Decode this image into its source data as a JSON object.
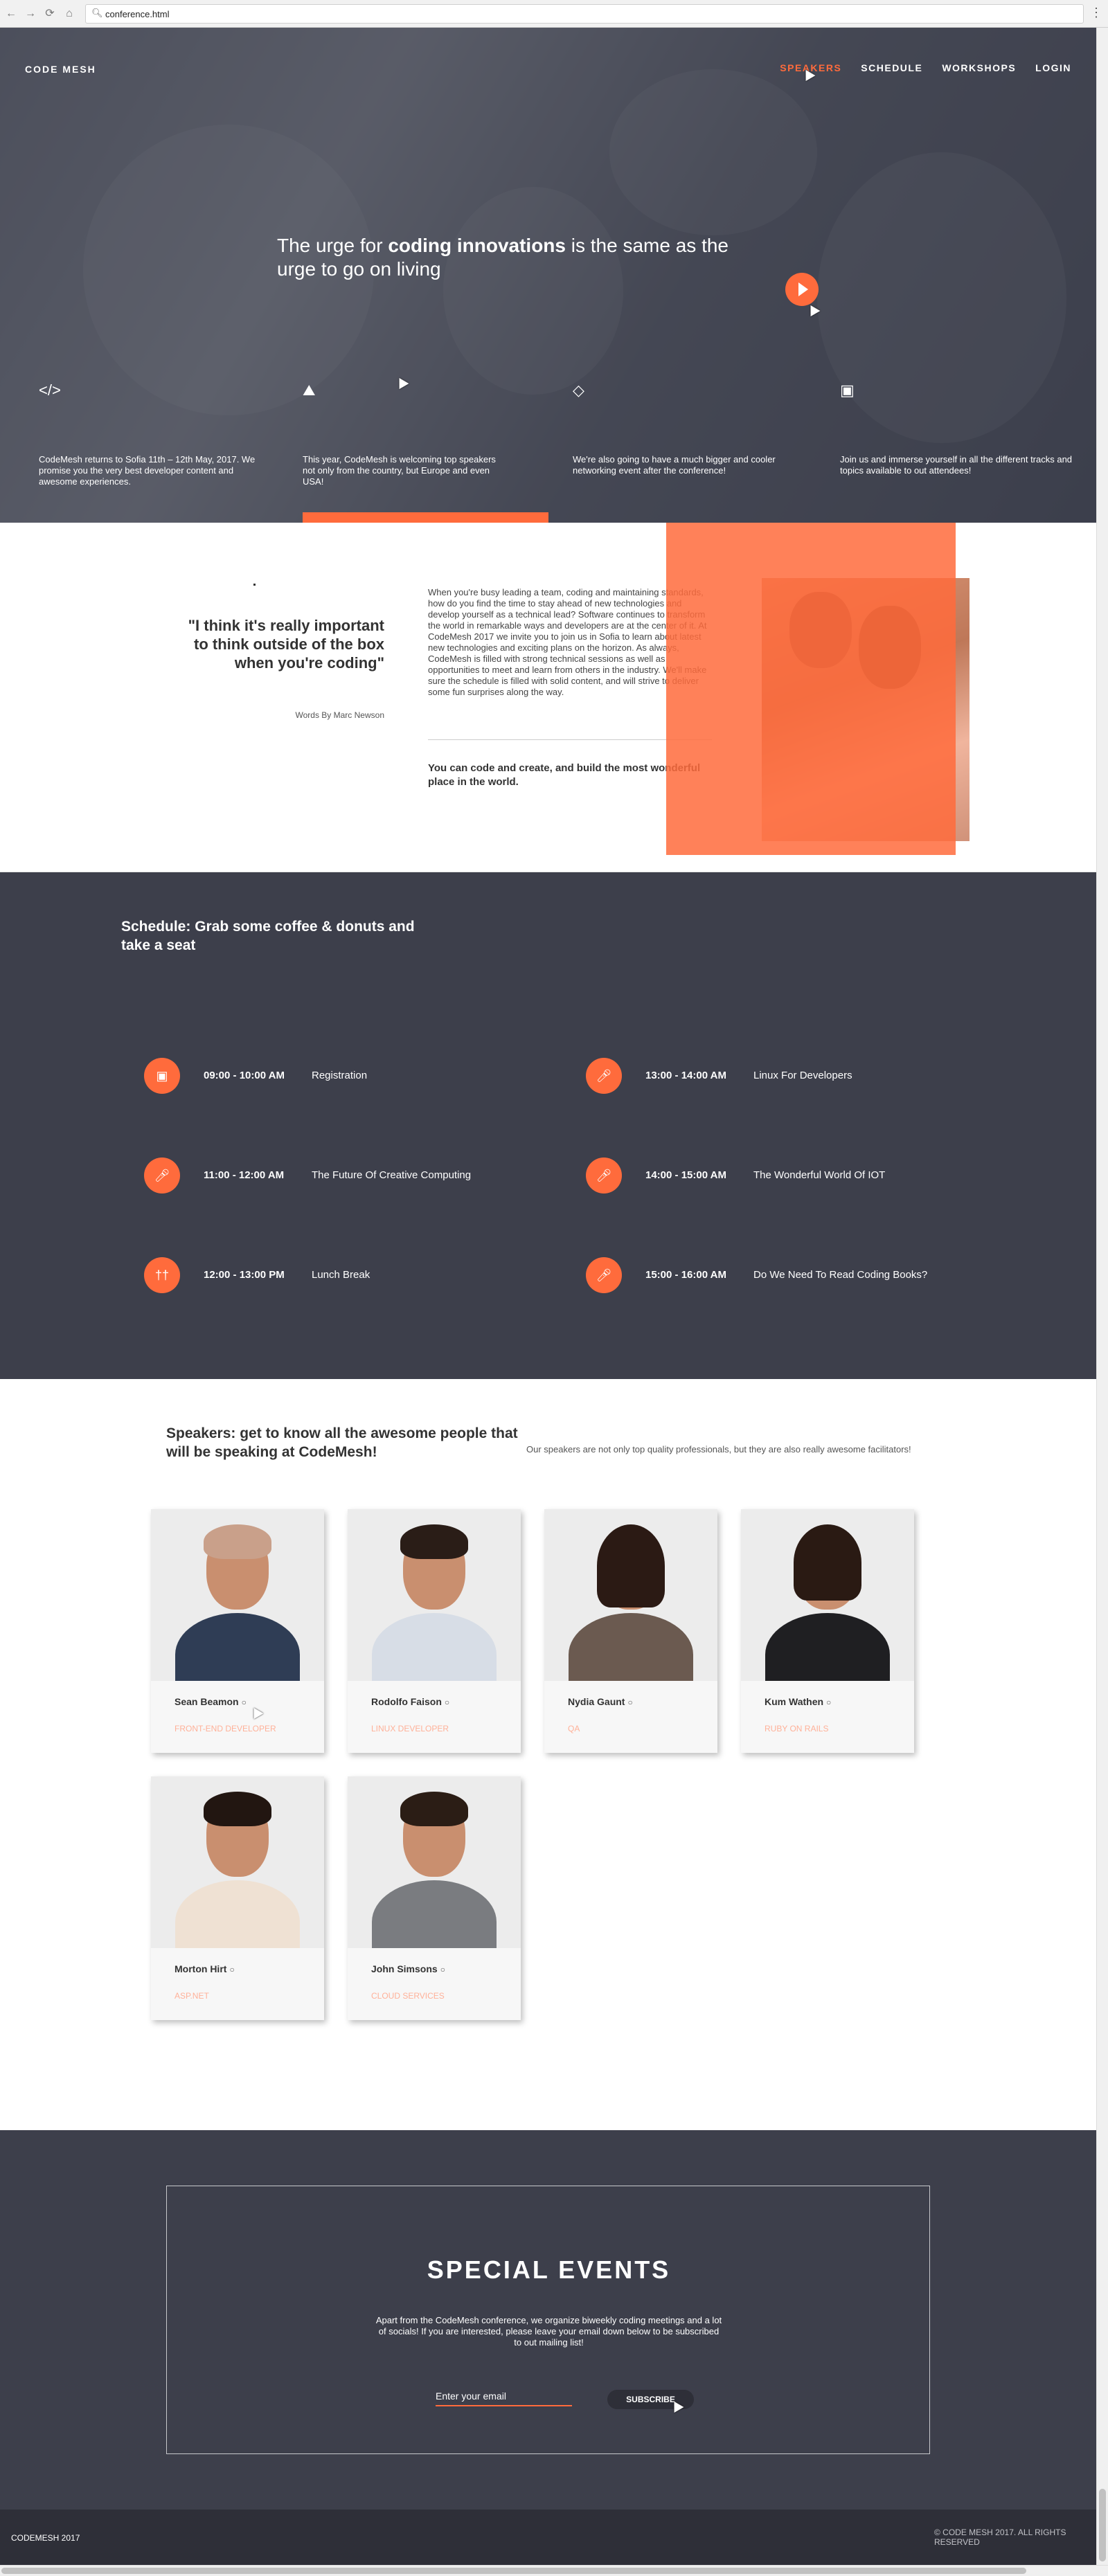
{
  "browser": {
    "url": "conference.html",
    "back": "←",
    "forward": "→",
    "reload": "⟳",
    "home": "⌂",
    "menu": "⋮"
  },
  "header": {
    "brand": "CODE MESH",
    "nav": [
      {
        "label": "SPEAKERS",
        "active": true
      },
      {
        "label": "SCHEDULE",
        "active": false
      },
      {
        "label": "WORKSHOPS",
        "active": false
      },
      {
        "label": "LOGIN",
        "active": false
      }
    ]
  },
  "hero": {
    "headline_pre": "The urge for ",
    "headline_bold": "coding innovations",
    "headline_post": " is the same as the urge to go on living",
    "features": [
      {
        "icon": "code-icon",
        "text": "CodeMesh returns to Sofia 11th – 12th May, 2017. We promise you the very best developer content and awesome experiences."
      },
      {
        "icon": "area-chart-icon",
        "text": "This year, CodeMesh is welcoming top speakers not only from the country, but Europe and even USA!"
      },
      {
        "icon": "diamond-icon",
        "text": "We're also going to have a much bigger and cooler networking event after the conference!"
      },
      {
        "icon": "cube-icon",
        "text": "Join us and immerse yourself in all the different tracks and topics available to out attendees!"
      }
    ]
  },
  "about": {
    "quote": "\"I think it's really important to think outside of the box when you're coding\"",
    "author": "Words By Marc Newson",
    "body": "When you're busy leading a team, coding and maintaining standards, how do you find the time to stay ahead of new technologies and develop yourself as a technical lead? Software continues to transform the world in remarkable ways and developers are at the center of it. At CodeMesh 2017 we invite you to join us in Sofia to learn about latest new technologies and exciting plans on the horizon. As always, CodeMesh is filled with strong technical sessions as well as opportunities to meet and learn from others in the industry. We'll make sure the schedule is filled with solid content, and will strive to deliver some fun surprises along the way.",
    "tagline": "You can code and create, and build the most wonderful place in the world."
  },
  "schedule": {
    "title": "Schedule: Grab some coffee & donuts and take a seat",
    "items": [
      {
        "icon": "presentation-icon",
        "time": "09:00 - 10:00 AM",
        "title": "Registration"
      },
      {
        "icon": "microphone-icon",
        "time": "13:00 - 14:00 AM",
        "title": "Linux For Developers"
      },
      {
        "icon": "microphone-icon",
        "time": "11:00 - 12:00 AM",
        "title": "The Future Of Creative Computing"
      },
      {
        "icon": "microphone-icon",
        "time": "14:00 - 15:00 AM",
        "title": "The Wonderful World Of IOT"
      },
      {
        "icon": "cutlery-icon",
        "time": "12:00 - 13:00 PM",
        "title": "Lunch Break"
      },
      {
        "icon": "microphone-icon",
        "time": "15:00 - 16:00 AM",
        "title": "Do We Need To Read Coding Books?"
      }
    ]
  },
  "speakers": {
    "title": "Speakers: get to know all the awesome people that will be speaking at CodeMesh!",
    "subtitle": "Our speakers are not only top quality professionals, but they are also really awesome facilitators!",
    "list": [
      {
        "name": "Sean Beamon",
        "role": "FRONT-END DEVELOPER",
        "shirt": "#2f3d55",
        "hair": "#c9a08a"
      },
      {
        "name": "Rodolfo Faison",
        "role": "LINUX DEVELOPER",
        "shirt": "#d7dde6",
        "hair": "#2a1d17"
      },
      {
        "name": "Nydia Gaunt",
        "role": "QA",
        "shirt": "#6b5a50",
        "hair": "#2b1a14"
      },
      {
        "name": "Kum Wathen",
        "role": "RUBY ON RAILS",
        "shirt": "#1f1f22",
        "hair": "#2a1a13"
      },
      {
        "name": "Morton Hirt",
        "role": "ASP.NET",
        "shirt": "#efe1d3",
        "hair": "#221611"
      },
      {
        "name": "John Simsons",
        "role": "CLOUD SERVICES",
        "shirt": "#7a7c80",
        "hair": "#2b1d15"
      }
    ]
  },
  "events": {
    "title": "SPECIAL EVENTS",
    "text": "Apart from the CodeMesh conference, we organize biweekly coding meetings and a lot of socials! If you are interested, please leave your email down below to be subscribed to out mailing list!",
    "email_placeholder": "Enter your email",
    "subscribe_label": "SUBSCRIBE"
  },
  "footer": {
    "left": "CODEMESH 2017",
    "right": "© CODE MESH 2017. ALL RIGHTS RESERVED"
  },
  "colors": {
    "accent": "#ff6b3c",
    "dark": "#3d3f4b",
    "footer": "#2e2f38"
  }
}
